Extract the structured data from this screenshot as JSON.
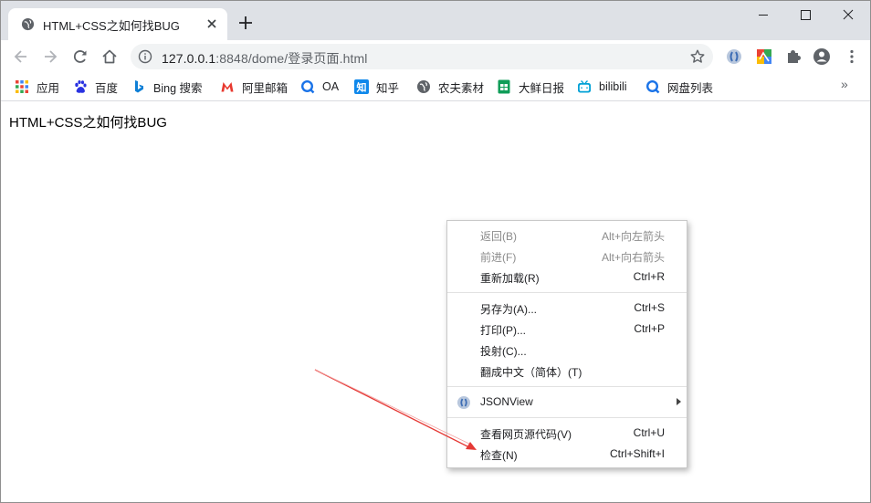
{
  "tab": {
    "title": "HTML+CSS之如何找BUG"
  },
  "address": {
    "host": "127.0.0.1",
    "rest": ":8848/dome/登录页面.html"
  },
  "bookmarks": [
    {
      "label": "应用",
      "icon": "apps-grid-icon"
    },
    {
      "label": "百度",
      "icon": "baidu-paw-icon"
    },
    {
      "label": "Bing 搜索",
      "icon": "bing-icon"
    },
    {
      "label": "阿里邮箱",
      "icon": "aliyun-mail-icon"
    },
    {
      "label": "OA",
      "icon": "oa-icon"
    },
    {
      "label": "知乎",
      "icon": "zhihu-icon"
    },
    {
      "label": "农夫素材",
      "icon": "globe-icon"
    },
    {
      "label": "大鲜日报",
      "icon": "sheet-icon"
    },
    {
      "label": "bilibili",
      "icon": "bilibili-icon"
    },
    {
      "label": "网盘列表",
      "icon": "cloud-disk-icon"
    }
  ],
  "page": {
    "heading": "HTML+CSS之如何找BUG"
  },
  "context_menu": {
    "items": [
      {
        "label": "返回(B)",
        "accel": "Alt+向左箭头",
        "disabled": true
      },
      {
        "label": "前进(F)",
        "accel": "Alt+向右箭头",
        "disabled": true
      },
      {
        "label": "重新加载(R)",
        "accel": "Ctrl+R",
        "disabled": false
      },
      {
        "label": "另存为(A)...",
        "accel": "Ctrl+S",
        "disabled": false
      },
      {
        "label": "打印(P)...",
        "accel": "Ctrl+P",
        "disabled": false
      },
      {
        "label": "投射(C)...",
        "accel": "",
        "disabled": false
      },
      {
        "label": "翻成中文（简体）(T)",
        "accel": "",
        "disabled": false
      },
      {
        "label": "JSONView",
        "accel": "",
        "disabled": false,
        "icon": "jsonview-icon",
        "submenu": true
      },
      {
        "label": "查看网页源代码(V)",
        "accel": "Ctrl+U",
        "disabled": false
      },
      {
        "label": "检查(N)",
        "accel": "Ctrl+Shift+I",
        "disabled": false
      }
    ]
  },
  "colors": {
    "tabstrip": "#dee1e6",
    "annotation_arrow": "#e53935",
    "menu_disabled_text": "#8b8b8b"
  }
}
